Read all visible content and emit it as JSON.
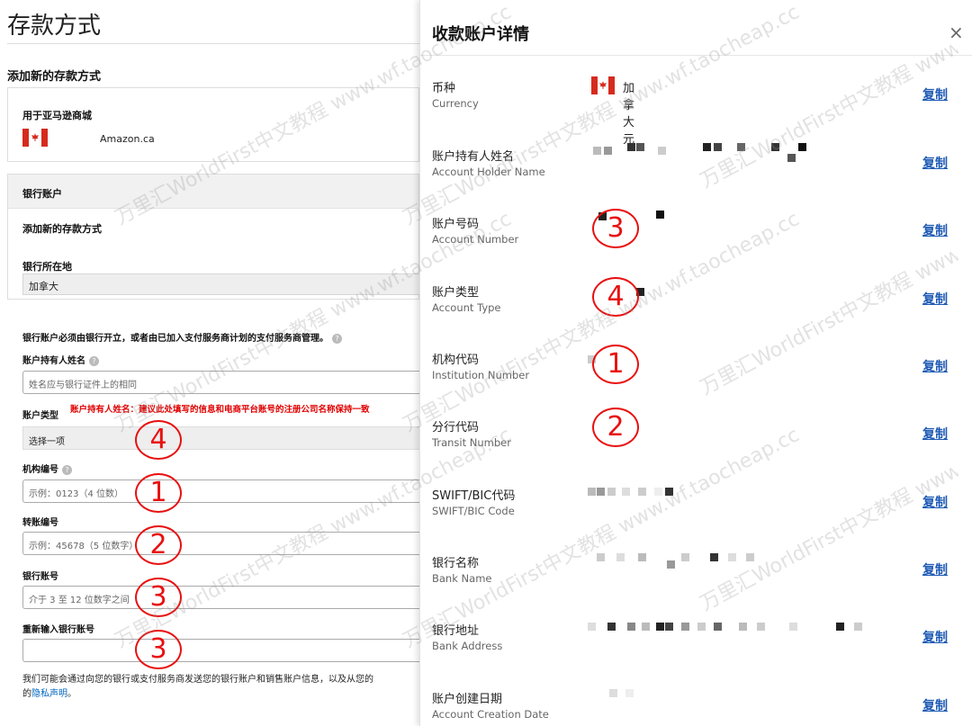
{
  "left": {
    "page_title": "存款方式",
    "section_title": "添加新的存款方式",
    "store": {
      "label": "用于亚马逊商城",
      "name": "Amazon.ca"
    },
    "bank_account": {
      "header": "银行账户",
      "add_new": "添加新的存款方式",
      "location_label": "银行所在地",
      "location_value": "加拿大"
    },
    "notice": "银行账户必须由银行开立，或者由已加入支付服务商计划的支付服务商管理。",
    "fields": {
      "holder_label": "账户持有人姓名",
      "holder_placeholder": "姓名应与银行证件上的相同",
      "red_note": "账户持有人姓名：建议此处填写的信息和电商平台账号的注册公司名称保持一致",
      "type_label": "账户类型",
      "type_value": "选择一项",
      "institution_label": "机构编号",
      "institution_placeholder": "示例：0123（4 位数）",
      "transit_label": "转账编号",
      "transit_placeholder": "示例：45678（5 位数字）",
      "account_label": "银行账号",
      "account_placeholder": "介于 3 至 12 位数字之间",
      "reenter_label": "重新输入银行账号",
      "reenter_placeholder": ""
    },
    "disclaimer_line1": "我们可能会通过向您的银行或支付服务商发送您的银行账户和销售账户信息，以及从您的",
    "disclaimer_prefix": "的",
    "privacy_link": "隐私声明",
    "disclaimer_suffix": "。"
  },
  "drawer": {
    "title": "收款账户详情",
    "close": "×",
    "copy_label": "复制",
    "currency_value": "加拿大元",
    "rows": [
      {
        "zh": "币种",
        "en": "Currency"
      },
      {
        "zh": "账户持有人姓名",
        "en": "Account Holder Name"
      },
      {
        "zh": "账户号码",
        "en": "Account Number"
      },
      {
        "zh": "账户类型",
        "en": "Account Type"
      },
      {
        "zh": "机构代码",
        "en": "Institution Number"
      },
      {
        "zh": "分行代码",
        "en": "Transit Number"
      },
      {
        "zh": "SWIFT/BIC代码",
        "en": "SWIFT/BIC Code"
      },
      {
        "zh": "银行名称",
        "en": "Bank Name"
      },
      {
        "zh": "银行地址",
        "en": "Bank Address"
      },
      {
        "zh": "账户创建日期",
        "en": "Account Creation Date"
      }
    ]
  },
  "annotations": {
    "left_type": "4",
    "left_institution": "1",
    "left_transit": "2",
    "left_account": "3",
    "left_reenter": "3",
    "right_account_number": "3",
    "right_account_type": "4",
    "right_institution": "1",
    "right_transit": "2"
  },
  "watermark": "万里汇WorldFirst中文教程 www.wf.taocheap.cc",
  "colors": {
    "annotation_red": "#e81010",
    "copy_blue": "#1e5ab4",
    "note_red": "#e00000",
    "flag_red": "#d52b1e"
  },
  "icons": {
    "info": "info-icon",
    "flag": "canada-flag-icon",
    "close": "close-icon"
  }
}
